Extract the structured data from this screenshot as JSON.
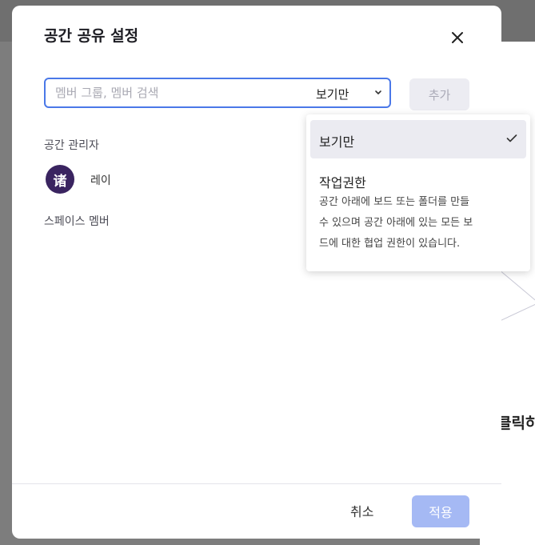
{
  "background": {
    "partial_text": "클릭하"
  },
  "modal": {
    "title": "공간 공유 설정",
    "close_icon": "close-icon",
    "search": {
      "placeholder": "멤버 그룹, 멤버 검색",
      "value": ""
    },
    "permission_select": {
      "selected": "보기만",
      "icon": "chevron-down-icon"
    },
    "add_button_label": "추가",
    "admins_section": {
      "title": "공간 관리자",
      "members": [
        {
          "avatar_text": "诸",
          "avatar_color": "#3a2460",
          "name": "레이"
        }
      ]
    },
    "members_section": {
      "title": "스페이스 멤버"
    },
    "footer": {
      "cancel_label": "취소",
      "apply_label": "적용"
    }
  },
  "permission_dropdown": {
    "options": [
      {
        "label": "보기만",
        "selected": true,
        "icon": "check-icon"
      },
      {
        "label": "작업권한",
        "selected": false,
        "description_lines": [
          "공간 아래에 보드 또는 폴더를 만들",
          "수 있으며 공간 아래에 있는 모든 보",
          "드에 대한 협업 권한이 있습니다."
        ]
      }
    ]
  },
  "colors": {
    "accent": "#4a78e8",
    "apply_button": "#a5b9f4",
    "add_button_bg": "#ececf2",
    "selected_option_bg": "#ebebf1",
    "overlay": "#7d7d7d"
  }
}
